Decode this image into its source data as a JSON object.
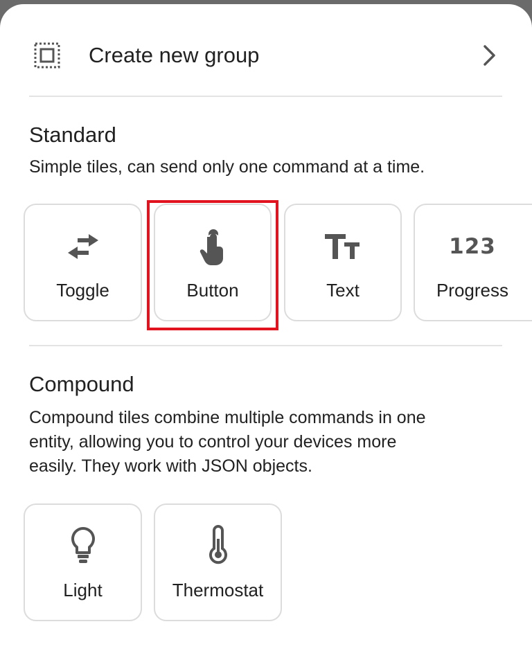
{
  "create_group": {
    "label": "Create new group",
    "icon": "dashed-group-icon",
    "chevron": "chevron-right-icon"
  },
  "standard": {
    "title": "Standard",
    "description": "Simple tiles, can send only one command at a time.",
    "tiles": [
      {
        "label": "Toggle",
        "icon": "swap-arrows-icon"
      },
      {
        "label": "Button",
        "icon": "touch-hand-icon"
      },
      {
        "label": "Text",
        "icon": "text-size-icon"
      },
      {
        "label": "Progress",
        "icon": "numbers-icon",
        "icon_text": "123"
      }
    ]
  },
  "compound": {
    "title": "Compound",
    "description_lines": [
      "Compound tiles combine multiple commands in one",
      "entity, allowing you to control your devices more",
      "easily. They work with JSON objects."
    ],
    "tiles": [
      {
        "label": "Light",
        "icon": "lightbulb-icon"
      },
      {
        "label": "Thermostat",
        "icon": "thermometer-icon"
      }
    ]
  },
  "colors": {
    "highlight": "#e0131e",
    "icon": "#555555",
    "text": "#212121"
  }
}
